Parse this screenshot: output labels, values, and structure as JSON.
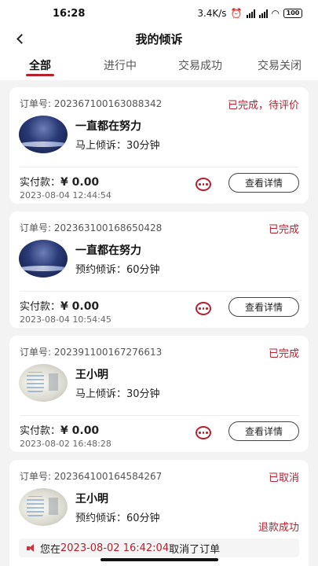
{
  "status_bar": {
    "time": "16:28",
    "speed": "3.4K/s",
    "battery": "100"
  },
  "header": {
    "title": "我的倾诉"
  },
  "tabs": [
    {
      "label": "全部"
    },
    {
      "label": "进行中"
    },
    {
      "label": "交易成功"
    },
    {
      "label": "交易关闭"
    }
  ],
  "orders": [
    {
      "order_no": "订单号: 202367100163088342",
      "status": "已完成，待评价",
      "name": "一直都在努力",
      "service": "马上倾诉：30分钟",
      "paid_label": "实付款：",
      "paid_amount": "¥ 0.00",
      "time": "2023-08-04 12:44:54",
      "detail_label": "查看详情"
    },
    {
      "order_no": "订单号: 202363100168650428",
      "status": "已完成",
      "name": "一直都在努力",
      "service": "预约倾诉：60分钟",
      "paid_label": "实付款：",
      "paid_amount": "¥ 0.00",
      "time": "2023-08-04 10:54:45",
      "detail_label": "查看详情"
    },
    {
      "order_no": "订单号: 202391100167276613",
      "status": "已完成",
      "name": "王小明",
      "service": "马上倾诉：30分钟",
      "paid_label": "实付款：",
      "paid_amount": "¥ 0.00",
      "time": "2023-08-02 16:48:28",
      "detail_label": "查看详情"
    },
    {
      "order_no": "订单号: 202364100164584267",
      "status": "已取消",
      "name": "王小明",
      "service": "预约倾诉：60分钟",
      "refund_status": "退款成功",
      "notice_prefix": "您在",
      "notice_time": "2023-08-02 16:42:04",
      "notice_suffix": "取消了订单"
    }
  ],
  "colors": {
    "accent": "#b5202e",
    "background": "#f3f3f3"
  }
}
